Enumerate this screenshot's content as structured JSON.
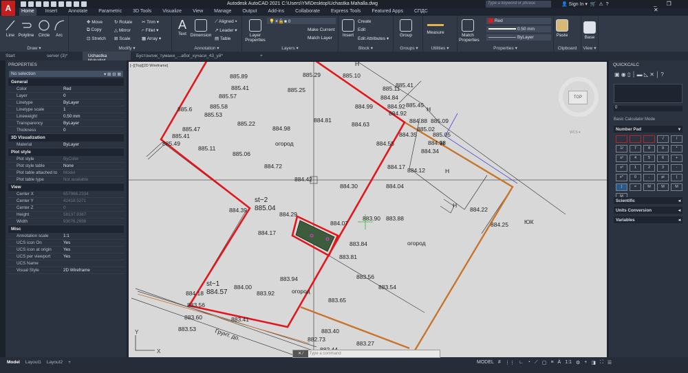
{
  "app": {
    "title": "Autodesk AutoCAD 2021   C:\\Users\\YM\\Desktop\\Uchastka Mahalla.dwg",
    "logo": "A",
    "search_placeholder": "Type a keyword or phrase",
    "sign_in": "Sign In",
    "window_controls": "_ ❐ ✕"
  },
  "ribbon_tabs": [
    "Home",
    "Insert",
    "Annotate",
    "Parametric",
    "3D Tools",
    "Visualize",
    "View",
    "Manage",
    "Output",
    "Add-ins",
    "Collaborate",
    "Express Tools",
    "Featured Apps",
    "СПДС"
  ],
  "draw": {
    "label": "Draw ▾",
    "line": "Line",
    "polyline": "Polyline",
    "circle": "Circle",
    "arc": "Arc"
  },
  "modify": {
    "label": "Modify ▾",
    "move": "Move",
    "rotate": "Rotate",
    "trim": "Trim ▾",
    "copy": "Copy",
    "mirror": "Mirror",
    "fillet": "Fillet ▾",
    "stretch": "Stretch",
    "scale": "Scale",
    "array": "Array ▾"
  },
  "annotation": {
    "label": "Annotation ▾",
    "text": "Text",
    "dimension": "Dimension",
    "aligned": "Aligned ▾",
    "leader": "Leader ▾",
    "table": "Table"
  },
  "layers": {
    "label": "Layers ▾",
    "layer_properties": "Layer Properties",
    "current_layer": "0",
    "make_current": "Make Current",
    "match_layer": "Match Layer"
  },
  "block": {
    "label": "Block ▾",
    "insert": "Insert",
    "create": "Create",
    "edit": "Edit",
    "edit_attributes": "Edit Attributes ▾"
  },
  "groups": {
    "label": "Groups ▾",
    "group": "Group"
  },
  "utilities": {
    "label": "Utilities ▾",
    "measure": "Measure"
  },
  "properties_panel": {
    "label": "Properties ▾",
    "match": "Match Properties",
    "color": "Red",
    "lineweight": "0.50 mm",
    "linetype": "ByLayer"
  },
  "clipboard": {
    "label": "Clipboard",
    "paste": "Paste"
  },
  "view_panel": {
    "label": "View ▾",
    "base": "Base"
  },
  "doc_tabs": [
    "Start",
    "server (3)*",
    "Uchastka Mahalla*",
    "Бустонлик_тумани_...абог_кучаси_43_уй*",
    "+"
  ],
  "properties": {
    "title": "PROPERTIES",
    "selection": "No selection",
    "sections": [
      {
        "name": "General",
        "rows": [
          [
            "Color",
            "Red"
          ],
          [
            "Layer",
            "0"
          ],
          [
            "Linetype",
            "ByLayer"
          ],
          [
            "Linetype scale",
            "1"
          ],
          [
            "Lineweight",
            "0.50 mm"
          ],
          [
            "Transparency",
            "ByLayer"
          ],
          [
            "Thickness",
            "0"
          ]
        ]
      },
      {
        "name": "3D Visualization",
        "rows": [
          [
            "Material",
            "ByLayer"
          ]
        ]
      },
      {
        "name": "Plot style",
        "rows": [
          [
            "Plot style",
            "ByColor"
          ],
          [
            "Plot style table",
            "None"
          ],
          [
            "Plot table attached to",
            "Model"
          ],
          [
            "Plot table type",
            "Not available"
          ]
        ]
      },
      {
        "name": "View",
        "rows": [
          [
            "Center X",
            "657966.2334"
          ],
          [
            "Center Y",
            "42418.5271"
          ],
          [
            "Center Z",
            "0"
          ],
          [
            "Height",
            "58137.9387"
          ],
          [
            "Width",
            "93076.2698"
          ]
        ]
      },
      {
        "name": "Misc",
        "rows": [
          [
            "Annotation scale",
            "1:1"
          ],
          [
            "UCS icon On",
            "Yes"
          ],
          [
            "UCS icon at origin",
            "Yes"
          ],
          [
            "UCS per viewport",
            "Yes"
          ],
          [
            "UCS Name",
            ""
          ],
          [
            "Visual Style",
            "2D Wireframe"
          ]
        ]
      }
    ]
  },
  "viewport": {
    "label": "[−][Top][2D Wireframe]",
    "viewcube": "TOP",
    "wcs": "WCS ▾",
    "compass_w": "W",
    "y_axis": "Y",
    "x_axis": "X"
  },
  "drawing": {
    "labels": [
      "885.89",
      "885.41",
      "885.57",
      "885.58",
      "885.53",
      "885.6",
      "885.47",
      "885.41",
      "885.49",
      "885.11",
      "885.22",
      "885.06",
      "884.98",
      "огород",
      "884.72",
      "885.25",
      "885.29",
      "884.81",
      "884.42",
      "885.10",
      "884.99",
      "884.63",
      "884.84",
      "885.11",
      "885.41",
      "885.45",
      "884.92",
      "884.92",
      "884.88",
      "885.02",
      "885.09",
      "885.05",
      "884.98",
      "884.35",
      "884.34",
      "884.55",
      "884.17",
      "884.12",
      "884.30",
      "884.04",
      "884.22",
      "884.25",
      "st−2",
      "885.04",
      "884.39",
      "884.29",
      "884.17",
      "884.07",
      "883.90",
      "883.88",
      "883.84",
      "огород",
      "883.81",
      "883.94",
      "883.56",
      "883.54",
      "884.00",
      "883.92",
      "883.65",
      "огород",
      "st−1",
      "884.57",
      "884.18",
      "883.56",
      "883.60",
      "883.41",
      "883.53",
      "Грунт. до.",
      "883.40",
      "882.73",
      "883.27",
      "882.44",
      "883.11",
      "Н",
      "Н",
      "Н",
      "Н",
      "Н",
      "ЮК"
    ]
  },
  "command": {
    "placeholder": "Type a command"
  },
  "quickcalc": {
    "title": "QUICKCALC",
    "value": "0",
    "mode": "Basic Calculator Mode",
    "number_pad": "Number Pad",
    "keys": [
      "",
      "",
      "",
      "√",
      "/",
      "1/",
      "7",
      "8",
      "9",
      "*",
      "x²",
      "4",
      "5",
      "6",
      "+",
      "x³",
      "1",
      "2",
      "3",
      "-",
      "x^",
      "0",
      ".",
      "pi",
      "(",
      ")",
      "=",
      "M",
      "M",
      "M",
      "M"
    ],
    "scientific": "Scientific",
    "units": "Units Conversion",
    "variables": "Variables"
  },
  "status": {
    "layouts": [
      "Model",
      "Layout1",
      "Layout2",
      "+"
    ],
    "model": "MODEL",
    "scale": "1:1"
  },
  "colors": {
    "boundary": "#e3161b",
    "orange": "#c8742a",
    "blue": "#4a4ad0",
    "canvas": "#d8d8d8"
  }
}
